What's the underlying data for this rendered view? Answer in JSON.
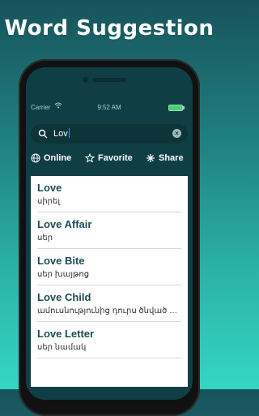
{
  "headline": "Word Suggestion",
  "status_bar": {
    "carrier": "Carrier",
    "time": "9:52 AM"
  },
  "search": {
    "query": "Lov",
    "icon": "search-icon"
  },
  "tabs": [
    {
      "label": "Online",
      "icon": "globe-icon"
    },
    {
      "label": "Favorite",
      "icon": "star-icon"
    },
    {
      "label": "Share",
      "icon": "share-icon"
    }
  ],
  "results": [
    {
      "word": "Love",
      "meaning": "սիրել"
    },
    {
      "word": "Love Affair",
      "meaning": "սեր"
    },
    {
      "word": "Love Bite",
      "meaning": "սեր խայթոց"
    },
    {
      "word": "Love Child",
      "meaning": "ամուսնությունից դուրս ծնված երեխա"
    },
    {
      "word": "Love Letter",
      "meaning": "սեր նամակ"
    }
  ],
  "colors": {
    "accent": "#2ea0ff",
    "word": "#1e4c56",
    "background": "#0f3f44"
  }
}
